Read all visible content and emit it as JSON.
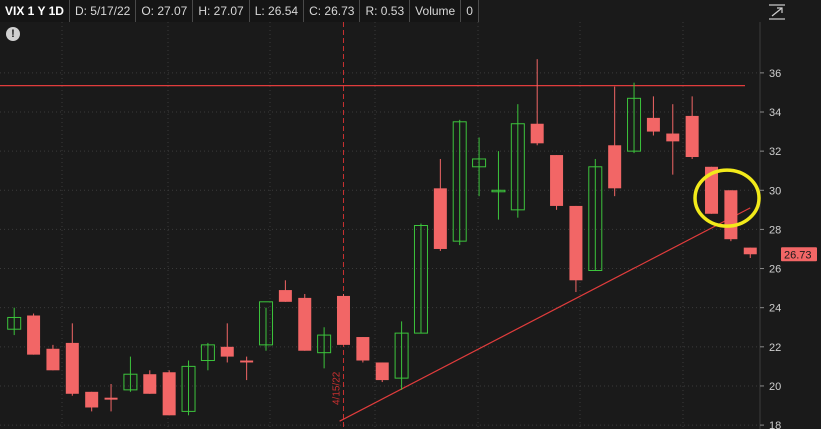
{
  "header": {
    "symbol": "VIX 1 Y 1D",
    "date": "D: 5/17/22",
    "open": "O: 27.07",
    "high": "H: 27.07",
    "low": "L: 26.54",
    "close": "C: 26.73",
    "range": "R: 0.53",
    "volume_label": "Volume",
    "volume_value": "0"
  },
  "info_icon_glyph": "!",
  "colors": {
    "background": "#1a1a1a",
    "up": "#3cc43c",
    "down": "#f26666",
    "level_line": "#e03c3c",
    "trendline": "#e03c3c",
    "vline": "#c83030",
    "highlight_circle": "#f2ea1a",
    "last_price_bg": "#f26666"
  },
  "chart_data": {
    "type": "candlestick",
    "title": "VIX 1 Y 1D",
    "ylim": [
      17.8,
      38.6
    ],
    "y_ticks": [
      18,
      20,
      22,
      24,
      26,
      28,
      30,
      32,
      34,
      36
    ],
    "grid": true,
    "last_price_label": "26.73",
    "vline_label": "4/15/22",
    "candles": [
      {
        "o": 22.9,
        "h": 24.0,
        "l": 22.6,
        "c": 23.5
      },
      {
        "o": 23.6,
        "h": 23.7,
        "l": 21.6,
        "c": 21.6
      },
      {
        "o": 21.9,
        "h": 22.1,
        "l": 20.8,
        "c": 20.8
      },
      {
        "o": 22.2,
        "h": 23.2,
        "l": 19.5,
        "c": 19.6
      },
      {
        "o": 19.7,
        "h": 19.7,
        "l": 18.7,
        "c": 18.9
      },
      {
        "o": 19.4,
        "h": 20.1,
        "l": 18.7,
        "c": 19.3
      },
      {
        "o": 19.8,
        "h": 21.5,
        "l": 19.7,
        "c": 20.6
      },
      {
        "o": 20.6,
        "h": 20.8,
        "l": 19.6,
        "c": 19.6
      },
      {
        "o": 20.7,
        "h": 20.8,
        "l": 18.5,
        "c": 18.5
      },
      {
        "o": 18.7,
        "h": 21.3,
        "l": 18.5,
        "c": 21.0
      },
      {
        "o": 21.3,
        "h": 22.2,
        "l": 20.8,
        "c": 22.1
      },
      {
        "o": 22.0,
        "h": 23.2,
        "l": 21.2,
        "c": 21.5
      },
      {
        "o": 21.3,
        "h": 21.5,
        "l": 20.3,
        "c": 21.2
      },
      {
        "o": 22.1,
        "h": 24.0,
        "l": 21.8,
        "c": 24.3
      },
      {
        "o": 24.9,
        "h": 25.4,
        "l": 24.3,
        "c": 24.3
      },
      {
        "o": 24.5,
        "h": 24.7,
        "l": 21.8,
        "c": 21.8
      },
      {
        "o": 21.7,
        "h": 23.0,
        "l": 20.9,
        "c": 22.6
      },
      {
        "o": 24.6,
        "h": 24.7,
        "l": 22.1,
        "c": 22.1
      },
      {
        "o": 22.5,
        "h": 22.5,
        "l": 21.2,
        "c": 21.3
      },
      {
        "o": 21.2,
        "h": 21.2,
        "l": 20.2,
        "c": 20.3
      },
      {
        "o": 20.4,
        "h": 23.3,
        "l": 19.8,
        "c": 22.7
      },
      {
        "o": 22.7,
        "h": 28.3,
        "l": 22.7,
        "c": 28.2
      },
      {
        "o": 30.1,
        "h": 31.6,
        "l": 26.9,
        "c": 27.0
      },
      {
        "o": 27.4,
        "h": 33.6,
        "l": 27.2,
        "c": 33.5
      },
      {
        "o": 31.2,
        "h": 32.7,
        "l": 29.7,
        "c": 31.6
      },
      {
        "o": 30.0,
        "h": 32.0,
        "l": 28.5,
        "c": 30.0
      },
      {
        "o": 29.0,
        "h": 34.4,
        "l": 28.6,
        "c": 33.4
      },
      {
        "o": 33.4,
        "h": 36.7,
        "l": 32.3,
        "c": 32.4
      },
      {
        "o": 31.8,
        "h": 31.8,
        "l": 29.0,
        "c": 29.2
      },
      {
        "o": 29.2,
        "h": 29.2,
        "l": 24.8,
        "c": 25.4
      },
      {
        "o": 25.9,
        "h": 31.6,
        "l": 25.9,
        "c": 31.2
      },
      {
        "o": 32.3,
        "h": 35.3,
        "l": 29.7,
        "c": 30.1
      },
      {
        "o": 32.0,
        "h": 35.5,
        "l": 31.9,
        "c": 34.7
      },
      {
        "o": 33.7,
        "h": 34.8,
        "l": 32.8,
        "c": 33.0
      },
      {
        "o": 32.9,
        "h": 34.4,
        "l": 30.8,
        "c": 32.5
      },
      {
        "o": 33.8,
        "h": 34.8,
        "l": 31.6,
        "c": 31.7
      },
      {
        "o": 31.2,
        "h": 31.2,
        "l": 28.8,
        "c": 28.8
      },
      {
        "o": 30.0,
        "h": 30.0,
        "l": 27.4,
        "c": 27.5
      },
      {
        "o": 27.07,
        "h": 27.07,
        "l": 26.54,
        "c": 26.73
      }
    ],
    "level_line": {
      "y": 35.35
    },
    "trendline": {
      "from": {
        "index": 16.8,
        "y": 18.2
      },
      "to": {
        "index": 38.0,
        "y": 29.1
      }
    },
    "vline_index": 17.0,
    "highlight": {
      "center_index": 36.8,
      "center_y": 29.6
    }
  }
}
